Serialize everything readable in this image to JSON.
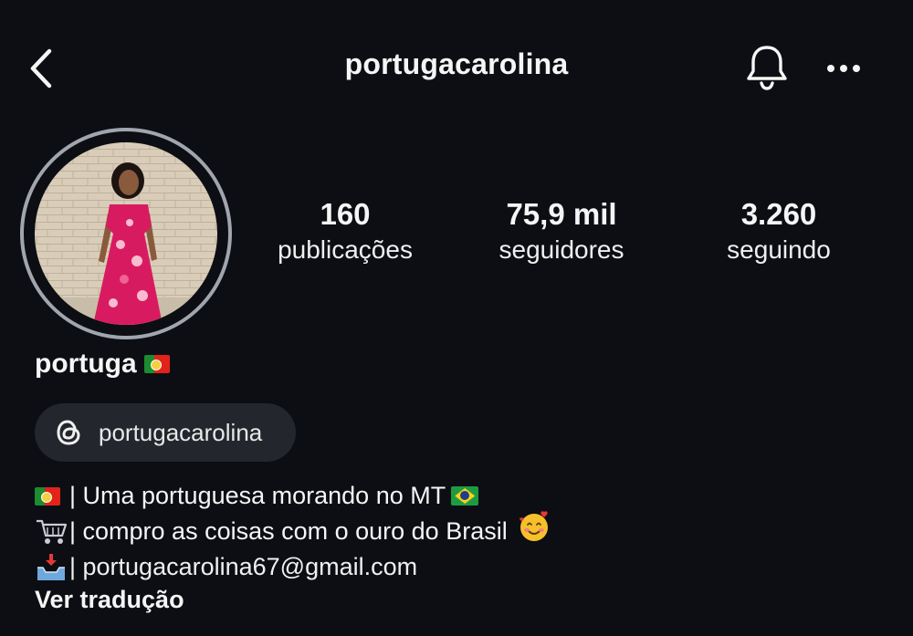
{
  "header": {
    "username": "portugacarolina"
  },
  "profile": {
    "stats": [
      {
        "value": "160",
        "label": "publicações"
      },
      {
        "value": "75,9 mil",
        "label": "seguidores"
      },
      {
        "value": "3.260",
        "label": "seguindo"
      }
    ],
    "display_name": "portuga"
  },
  "threads": {
    "handle": "portugacarolina"
  },
  "bio": {
    "line1": "| Uma portuguesa morando no MT",
    "line2": "| compro as coisas com o ouro do Brasil",
    "line3": "| portugacarolina67@gmail.com"
  },
  "translate_label": "Ver tradução",
  "colors": {
    "background": "#0c0e14",
    "pill": "#23262d",
    "ring": "#a1a5ae",
    "text": "#f5f5f5"
  }
}
